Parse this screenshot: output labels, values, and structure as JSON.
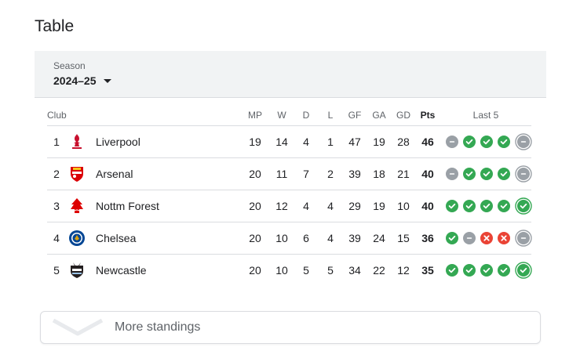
{
  "title": "Table",
  "season": {
    "label": "Season",
    "value": "2024–25"
  },
  "columns": {
    "club": "Club",
    "mp": "MP",
    "w": "W",
    "d": "D",
    "l": "L",
    "gf": "GF",
    "ga": "GA",
    "gd": "GD",
    "pts": "Pts",
    "last5": "Last 5"
  },
  "colors": {
    "win": "#34a853",
    "draw": "#9aa0a6",
    "loss": "#ea4335"
  },
  "rows": [
    {
      "pos": "1",
      "club": "Liverpool",
      "crest": "liverpool-crest-icon",
      "mp": "19",
      "w": "14",
      "d": "4",
      "l": "1",
      "gf": "47",
      "ga": "19",
      "gd": "28",
      "pts": "46",
      "form": [
        "D",
        "W",
        "W",
        "W",
        "D"
      ]
    },
    {
      "pos": "2",
      "club": "Arsenal",
      "crest": "arsenal-crest-icon",
      "mp": "20",
      "w": "11",
      "d": "7",
      "l": "2",
      "gf": "39",
      "ga": "18",
      "gd": "21",
      "pts": "40",
      "form": [
        "D",
        "W",
        "W",
        "W",
        "D"
      ]
    },
    {
      "pos": "3",
      "club": "Nottm Forest",
      "crest": "nottm-forest-crest-icon",
      "mp": "20",
      "w": "12",
      "d": "4",
      "l": "4",
      "gf": "29",
      "ga": "19",
      "gd": "10",
      "pts": "40",
      "form": [
        "W",
        "W",
        "W",
        "W",
        "W"
      ]
    },
    {
      "pos": "4",
      "club": "Chelsea",
      "crest": "chelsea-crest-icon",
      "mp": "20",
      "w": "10",
      "d": "6",
      "l": "4",
      "gf": "39",
      "ga": "24",
      "gd": "15",
      "pts": "36",
      "form": [
        "W",
        "D",
        "L",
        "L",
        "D"
      ]
    },
    {
      "pos": "5",
      "club": "Newcastle",
      "crest": "newcastle-crest-icon",
      "mp": "20",
      "w": "10",
      "d": "5",
      "l": "5",
      "gf": "34",
      "ga": "22",
      "gd": "12",
      "pts": "35",
      "form": [
        "W",
        "W",
        "W",
        "W",
        "W"
      ]
    }
  ],
  "more": {
    "label": "More standings"
  }
}
